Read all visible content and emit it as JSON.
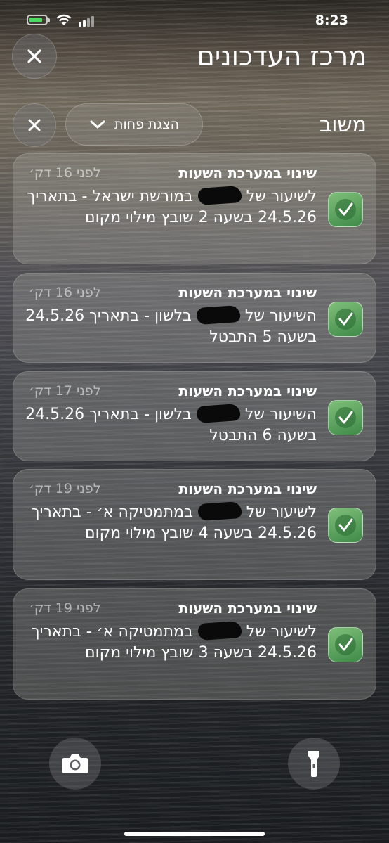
{
  "status_bar": {
    "time": "8:23",
    "battery_charging": true,
    "accent": "#4cd964"
  },
  "header": {
    "title": "מרכז העדכונים",
    "close_icon": "close-icon"
  },
  "section": {
    "label": "משוב",
    "show_less": "הצגת פחות",
    "dismiss_icon": "close-icon"
  },
  "notifications": [
    {
      "title": "שינוי במערכת השעות",
      "time": "לפני 16 דק׳",
      "body_before": "לשיעור של ",
      "body_after": " במורשת ישראל - בתאריך 24.5.26 בשעה 2 שובץ מילוי מקום"
    },
    {
      "title": "שינוי במערכת השעות",
      "time": "לפני 16 דק׳",
      "body_before": "השיעור של ",
      "body_after": " בלשון - בתאריך 24.5.26 בשעה 5 התבטל"
    },
    {
      "title": "שינוי במערכת השעות",
      "time": "לפני 17 דק׳",
      "body_before": "השיעור של ",
      "body_after": " בלשון - בתאריך 24.5.26 בשעה 6 התבטל"
    },
    {
      "title": "שינוי במערכת השעות",
      "time": "לפני 19 דק׳",
      "body_before": "לשיעור של ",
      "body_after": " במתמטיקה א׳ - בתאריך 24.5.26 בשעה 4 שובץ מילוי מקום"
    },
    {
      "title": "שינוי במערכת השעות",
      "time": "לפני 19 דק׳",
      "body_before": "לשיעור של ",
      "body_after": " במתמטיקה א׳ - בתאריך 24.5.26 בשעה 3 שובץ מילוי מקום"
    }
  ],
  "app_icon": {
    "name": "checkmark-app-icon",
    "color": "#4f9a55"
  },
  "bottom": {
    "left": "camera-icon",
    "right": "flashlight-icon"
  }
}
